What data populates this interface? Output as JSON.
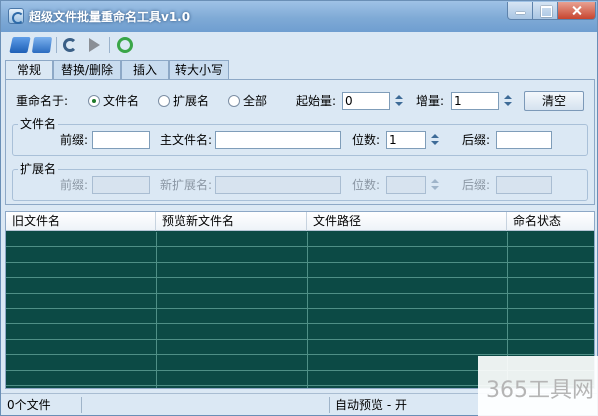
{
  "window": {
    "title": "超级文件批量重命名工具v1.0"
  },
  "toolbar": {
    "icons": [
      "open-folder-icon",
      "open-files-icon",
      "undo-icon",
      "run-icon",
      "recycle-icon"
    ]
  },
  "tabs": [
    {
      "label": "常规",
      "active": true
    },
    {
      "label": "替换/删除",
      "active": false
    },
    {
      "label": "插入",
      "active": false
    },
    {
      "label": "转大小写",
      "active": false
    }
  ],
  "general": {
    "rename_target_label": "重命名于:",
    "options": [
      "文件名",
      "扩展名",
      "全部"
    ],
    "selected_option": "文件名",
    "start_label": "起始量:",
    "start_value": "0",
    "step_label": "增量:",
    "step_value": "1",
    "clear_button": "清空"
  },
  "filename_group": {
    "title": "文件名",
    "prefix_label": "前缀:",
    "prefix_value": "",
    "main_label": "主文件名:",
    "main_value": "",
    "digits_label": "位数:",
    "digits_value": "1",
    "suffix_label": "后缀:",
    "suffix_value": ""
  },
  "extension_group": {
    "title": "扩展名",
    "prefix_label": "前缀:",
    "new_ext_label": "新扩展名:",
    "digits_label": "位数:",
    "suffix_label": "后缀:"
  },
  "table": {
    "columns": [
      "旧文件名",
      "预览新文件名",
      "文件路径",
      "命名状态"
    ],
    "rows": []
  },
  "statusbar": {
    "file_count": "0个文件",
    "auto_preview": "自动预览 - 开"
  },
  "watermark": {
    "text": "365工具网"
  },
  "colors": {
    "table_background": "#0c4a45",
    "window_background": "#dbe8f4",
    "titlebar": "#7faad6"
  }
}
